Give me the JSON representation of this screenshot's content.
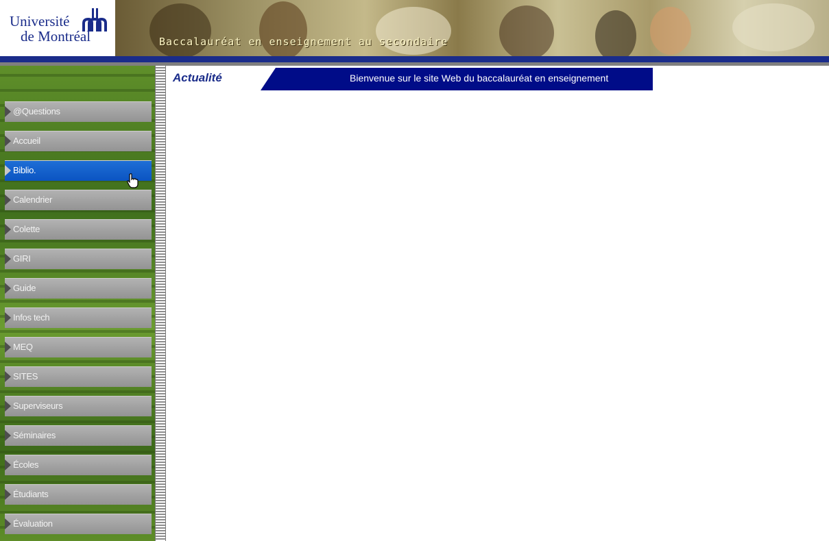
{
  "header": {
    "logo_line1": "Université",
    "logo_line2": "de Montréal",
    "banner_title": "Baccalauréat en enseignement au secondaire",
    "colors": {
      "brand_blue": "#1a2c8a",
      "ticker_blue": "#000c88"
    }
  },
  "content": {
    "section_title": "Actualité",
    "ticker_text": "Bienvenue sur le site Web du baccalauréat en enseignement"
  },
  "sidebar": {
    "items": [
      {
        "label": "@Questions"
      },
      {
        "label": "Accueil"
      },
      {
        "label": "Biblio."
      },
      {
        "label": "Calendrier"
      },
      {
        "label": "Colette"
      },
      {
        "label": "GIRI"
      },
      {
        "label": "Guide"
      },
      {
        "label": "Infos tech"
      },
      {
        "label": "MEQ"
      },
      {
        "label": "SITES"
      },
      {
        "label": "Superviseurs"
      },
      {
        "label": "Séminaires"
      },
      {
        "label": "Écoles"
      },
      {
        "label": "Étudiants"
      },
      {
        "label": "Évaluation"
      }
    ],
    "active_item": "Biblio.",
    "icons": {
      "nav_marker": "triangle-arrow-icon",
      "pointer": "hand-cursor-icon"
    }
  }
}
